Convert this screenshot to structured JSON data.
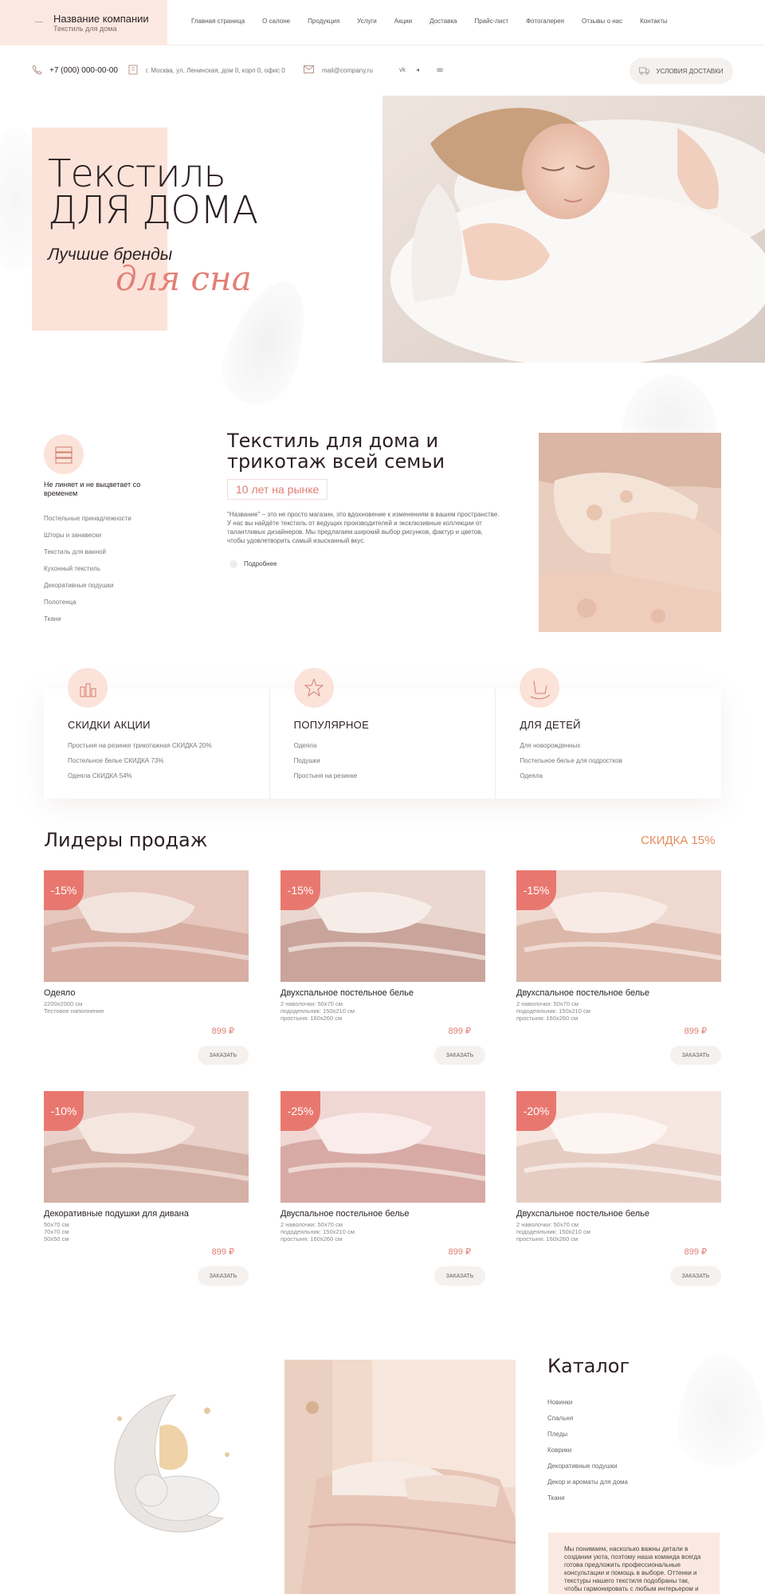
{
  "header": {
    "company_name": "Название компании",
    "company_sub": "Текстиль для дома",
    "menu": [
      "Главная страница",
      "О салоне",
      "Продукция",
      "Услуги",
      "Акции",
      "Доставка",
      "Прайс-лист",
      "Фотогалерея",
      "Отзывы о нас",
      "Контакты"
    ]
  },
  "contacts": {
    "phone": "+7 (000) 000-00-00",
    "address": "г. Москва, ул. Ленинская, дом 0, корп 0, офис 0",
    "email": "mail@company.ru",
    "social": [
      "vk",
      "telegram",
      "ok"
    ],
    "delivery_button": "УСЛОВИЯ ДОСТАВКИ"
  },
  "hero": {
    "title_line1": "Текстиль",
    "title_line2": "ДЛЯ ДОМА",
    "subtitle_line1": "Лучшие бренды",
    "subtitle_line2": "для сна"
  },
  "about": {
    "note": "Не линяет и не выцветает со временем",
    "categories": [
      "Постельные принадлежности",
      "Шторы и занавески",
      "Текстиль для ванной",
      "Кухонный текстиль",
      "Декоративные подушки",
      "Полотенца",
      "Ткани"
    ],
    "title": "Текстиль для дома и трикотаж всей семьи",
    "years_badge": "10 лет на рынке",
    "text": "\"Название\" – это не просто магазин, это вдохновение к изменениям в вашем пространстве. У нас вы найдёте текстиль от ведущих производителей и эксклюзивные коллекции от талантливых дизайнеров. Мы предлагаем широкий выбор рисунков, фактур и цветов, чтобы удовлетворить самый изысканный вкус.",
    "more": "Подробнее"
  },
  "feature_cards": [
    {
      "title": "СКИДКИ АКЦИИ",
      "items": [
        "Простыня на резинке трикотажная СКИДКА 20%",
        "Постельное белье СКИДКА 73%",
        "Одеяла СКИДКА 54%"
      ]
    },
    {
      "title": "ПОПУЛЯРНОЕ",
      "items": [
        "Одеяла",
        "Подушки",
        "Простыня на резинке"
      ]
    },
    {
      "title": "ДЛЯ ДЕТЕЙ",
      "items": [
        "Для новорожденных",
        "Постельное белье для подростков",
        "Одеяла"
      ]
    }
  ],
  "leaders": {
    "title": "Лидеры продаж",
    "discount": "СКИДКА 15%",
    "order_label": "ЗАКАЗАТЬ",
    "products": [
      {
        "badge": "-15%",
        "name": "Одеяло",
        "desc": [
          "2200x2000 см",
          "Тестовое наполнение"
        ],
        "price": "899 ₽"
      },
      {
        "badge": "-15%",
        "name": "Двухспальное постельное белье",
        "desc": [
          "2 наволочки: 50x70 см",
          "пододеяльник: 150x210 см",
          "простыня: 160x260 см"
        ],
        "price": "899 ₽"
      },
      {
        "badge": "-15%",
        "name": "Двухспальное постельное белье",
        "desc": [
          "2 наволочки: 50x70 см",
          "пододеяльник: 150x210 см",
          "простыня: 160x260 см"
        ],
        "price": "899 ₽"
      },
      {
        "badge": "-10%",
        "name": "Декоративные подушки для дивана",
        "desc": [
          "50x70 см",
          "70x70 см",
          "50x50 см"
        ],
        "price": "899 ₽"
      },
      {
        "badge": "-25%",
        "name": "Двуспальное постельное белье",
        "desc": [
          "2 наволочки: 50x70 см",
          "пододеяльник: 150x210 см",
          "простыня: 160x260 см"
        ],
        "price": "899 ₽"
      },
      {
        "badge": "-20%",
        "name": "Двухспальное постельное белье",
        "desc": [
          "2 наволочки: 50x70 см",
          "пододеяльник: 150x210 см",
          "простыня: 160x260 см"
        ],
        "price": "899 ₽"
      }
    ]
  },
  "catalog": {
    "title": "Каталог",
    "items": [
      "Новинки",
      "Спальня",
      "Пледы",
      "Коврики",
      "Декоративные подушки",
      "Декор и ароматы для дома",
      "Ткани"
    ],
    "note": "Мы понимаем, насколько важны детали в создании уюта, поэтому наша команда всегда готова предложить профессиональные консультации и помощь в выборе. Оттенки и текстуры нашего текстиля подобраны так, чтобы гармонировать с любым интерьером и"
  },
  "colors": {
    "accent": "#e8786f",
    "soft_pink": "#fbe3d9",
    "orange_text": "#e38b5c"
  }
}
